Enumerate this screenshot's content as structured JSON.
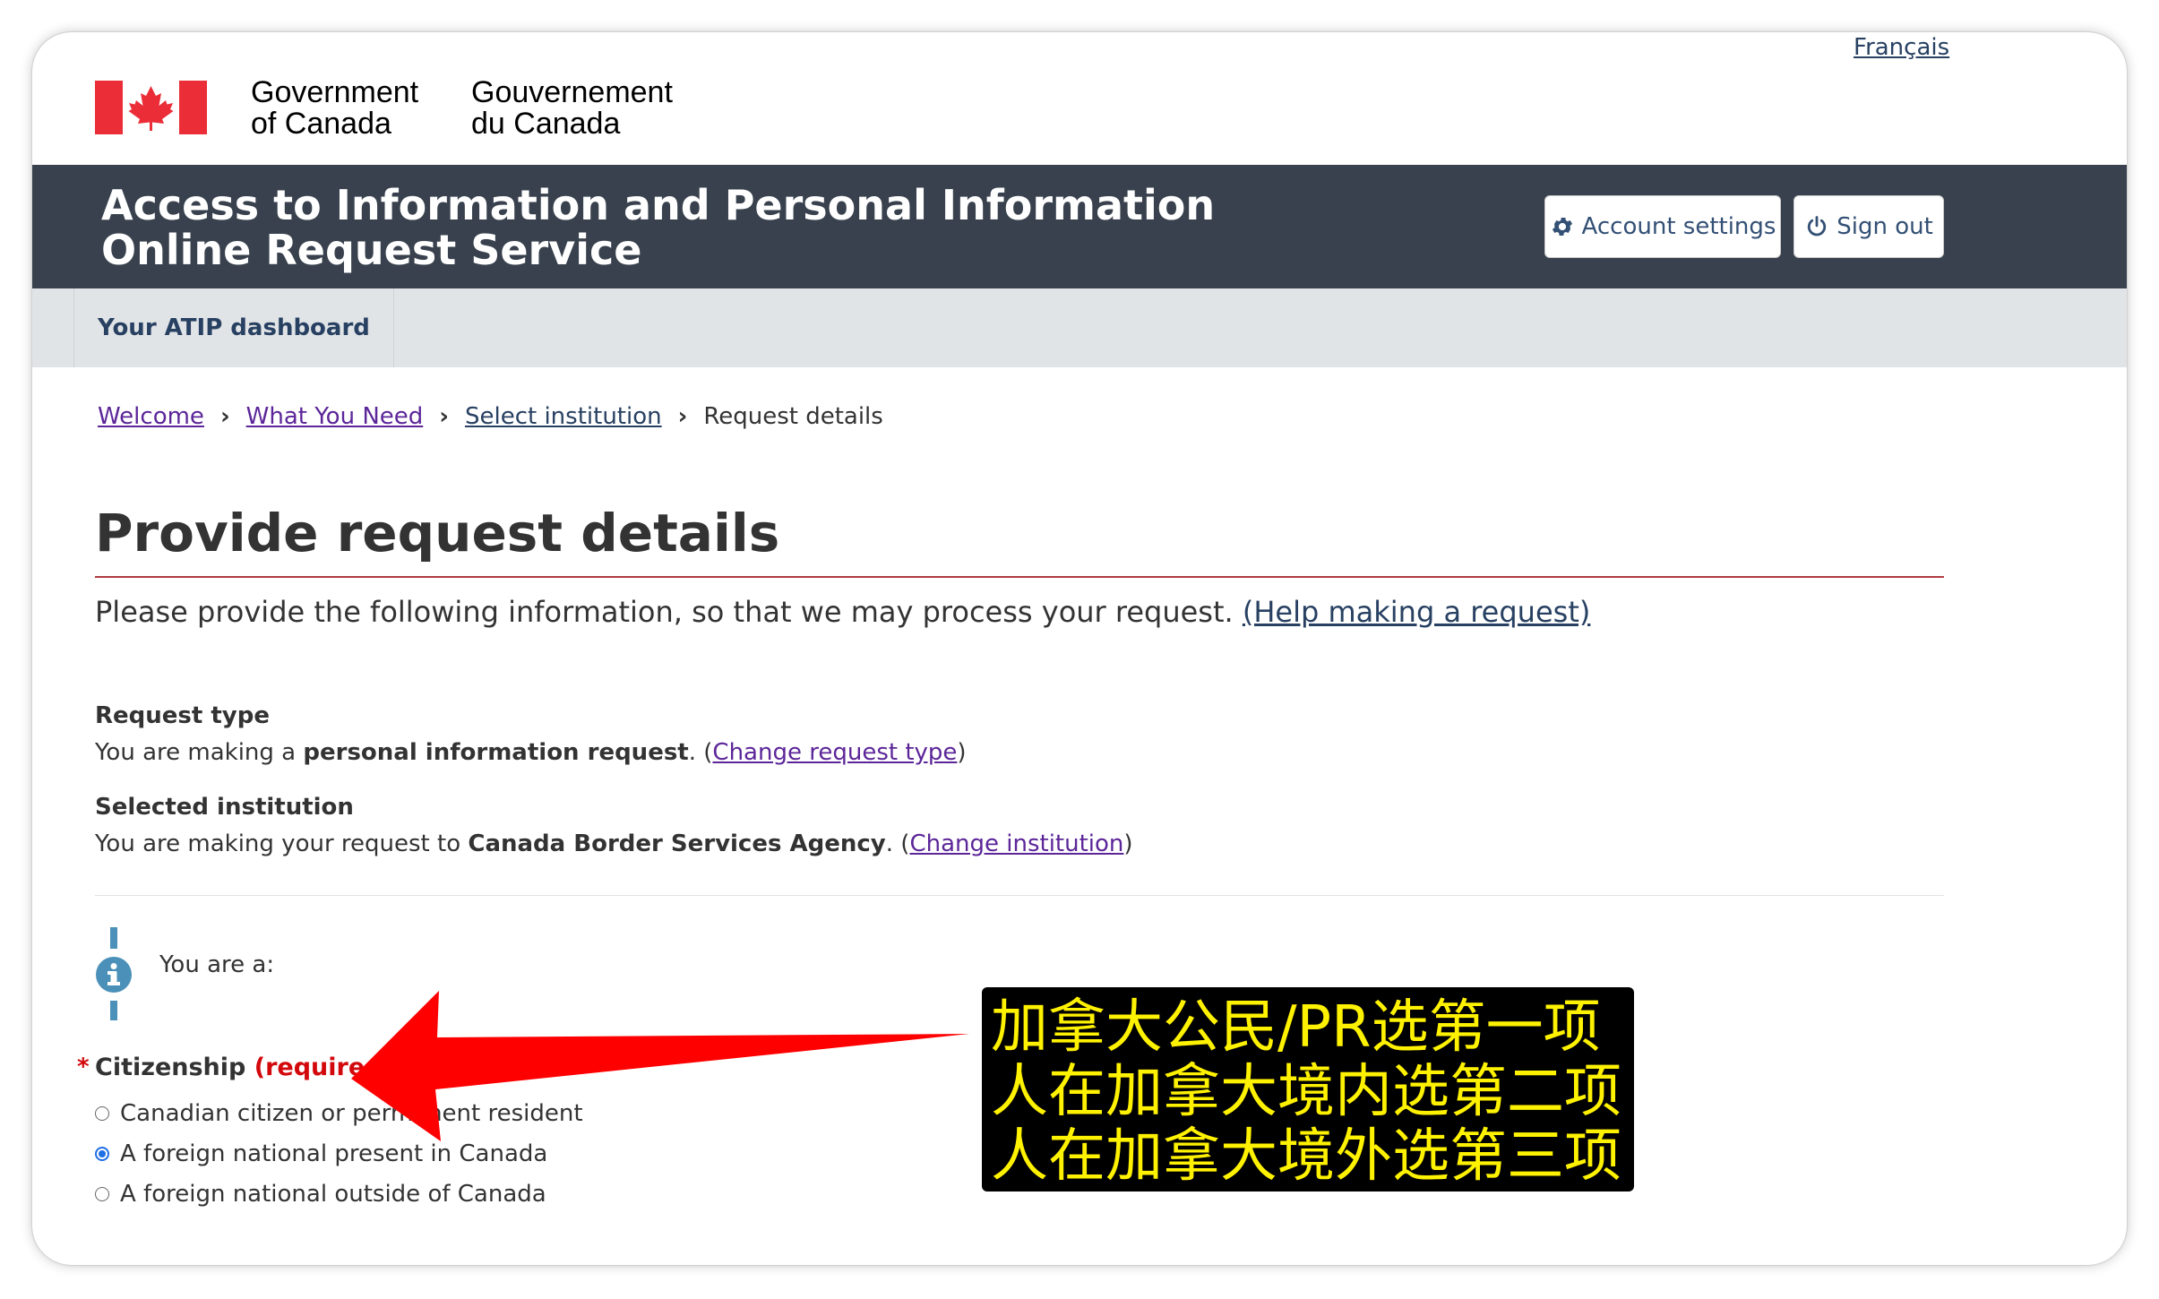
{
  "header": {
    "language_link": "Français",
    "signature_en": "Government\nof Canada",
    "signature_fr": "Gouvernement\ndu Canada",
    "app_title": "Access to Information and Personal Information\nOnline Request Service",
    "account_settings_label": "Account settings",
    "sign_out_label": "Sign out"
  },
  "nav": {
    "dashboard_label": "Your ATIP dashboard"
  },
  "breadcrumb": {
    "items": [
      "Welcome",
      "What You Need",
      "Select institution"
    ],
    "current": "Request details"
  },
  "page": {
    "title": "Provide request details",
    "intro_text": "Please provide the following information, so that we may process your request. ",
    "help_link": "(Help making a request)"
  },
  "request_type": {
    "label": "Request type",
    "prefix": "You are making a ",
    "value": "personal information request",
    "suffix": ". (",
    "change_link": "Change request type",
    "close": ")"
  },
  "institution": {
    "label": "Selected institution",
    "prefix": "You are making your request to ",
    "value": "Canada Border Services Agency",
    "suffix": ". (",
    "change_link": "Change institution",
    "close": ")"
  },
  "citizenship": {
    "prompt": "You are a:",
    "star": "*",
    "label": "Citizenship",
    "required_text": "(required)",
    "options": [
      {
        "label": "Canadian citizen or permanent resident",
        "selected": false
      },
      {
        "label": "A foreign national present in Canada",
        "selected": true
      },
      {
        "label": "A foreign national outside of Canada",
        "selected": false
      }
    ]
  },
  "annotation": {
    "lines": [
      "加拿大公民/PR选第一项",
      "人在加拿大境内选第二项",
      "人在加拿大境外选第三项"
    ]
  },
  "colors": {
    "app_band": "#38414d",
    "nav_band": "#e1e4e7",
    "visited_link": "#5c2699",
    "link": "#284162",
    "required": "#d3080c",
    "title_rule": "#af3c43",
    "annotation_text": "#fff200",
    "arrow": "#ff0000"
  }
}
